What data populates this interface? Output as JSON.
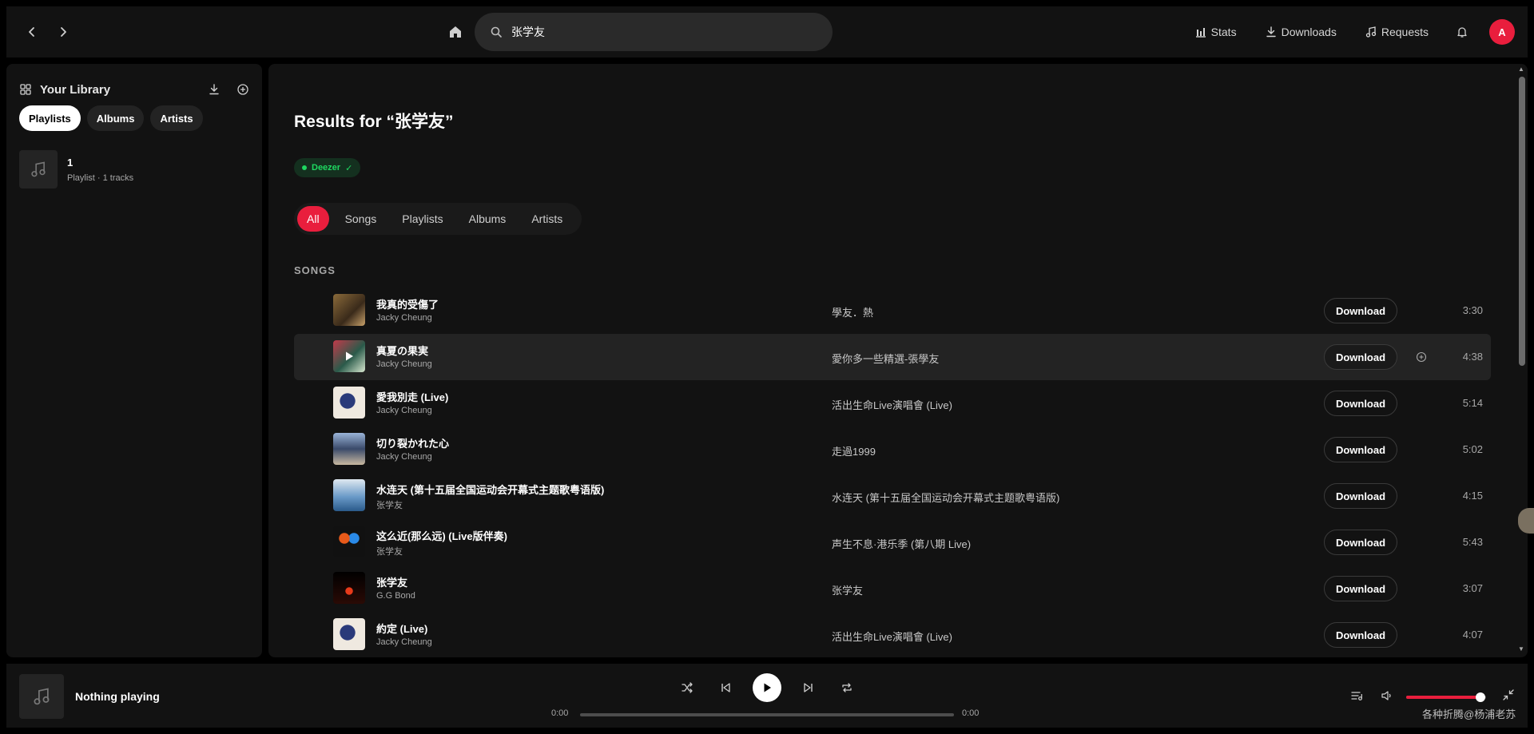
{
  "header": {
    "search_value": "张学友",
    "links": [
      {
        "label": "Stats",
        "icon": "bar-chart-icon"
      },
      {
        "label": "Downloads",
        "icon": "download-icon"
      },
      {
        "label": "Requests",
        "icon": "music-note-icon"
      }
    ],
    "avatar_letter": "A"
  },
  "sidebar": {
    "title": "Your Library",
    "chips": [
      "Playlists",
      "Albums",
      "Artists"
    ],
    "active_chip": "Playlists",
    "items": [
      {
        "name": "1",
        "subtitle": "Playlist · 1 tracks"
      }
    ]
  },
  "main": {
    "results_title": "Results for “张学友”",
    "provider": {
      "label": "Deezer",
      "check": "✓"
    },
    "filters": [
      "All",
      "Songs",
      "Playlists",
      "Albums",
      "Artists"
    ],
    "active_filter": "All",
    "section_label": "SONGS",
    "download_label": "Download",
    "songs": [
      {
        "title": "我真的受傷了",
        "artist": "Jacky Cheung",
        "album": "學友．熱",
        "duration": "3:30"
      },
      {
        "title": "真夏の果実",
        "artist": "Jacky Cheung",
        "album": "愛你多一些精選-張學友",
        "duration": "4:38"
      },
      {
        "title": "愛我別走 (Live)",
        "artist": "Jacky Cheung",
        "album": "活出生命Live演唱會 (Live)",
        "duration": "5:14"
      },
      {
        "title": "切り裂かれた心",
        "artist": "Jacky Cheung",
        "album": "走過1999",
        "duration": "5:02"
      },
      {
        "title": "水连天 (第十五届全国运动会开幕式主题歌粤语版)",
        "artist": "张学友",
        "album": "水连天 (第十五届全国运动会开幕式主题歌粤语版)",
        "duration": "4:15"
      },
      {
        "title": "这么近(那么远) (Live版伴奏)",
        "artist": "张学友",
        "album": "声生不息·港乐季 (第八期 Live)",
        "duration": "5:43"
      },
      {
        "title": "张学友",
        "artist": "G.G Bond",
        "album": "张学友",
        "duration": "3:07"
      },
      {
        "title": "約定 (Live)",
        "artist": "Jacky Cheung",
        "album": "活出生命Live演唱會 (Live)",
        "duration": "4:07"
      }
    ],
    "hover_row": 1
  },
  "player": {
    "now_playing": "Nothing playing",
    "time_current": "0:00",
    "time_total": "0:00",
    "progress": 0,
    "volume": 0.93
  },
  "watermark": "各种折腾@杨浦老苏",
  "colors": {
    "accent": "#e91e3d",
    "provider": "#1ed760",
    "background": "#121212"
  }
}
